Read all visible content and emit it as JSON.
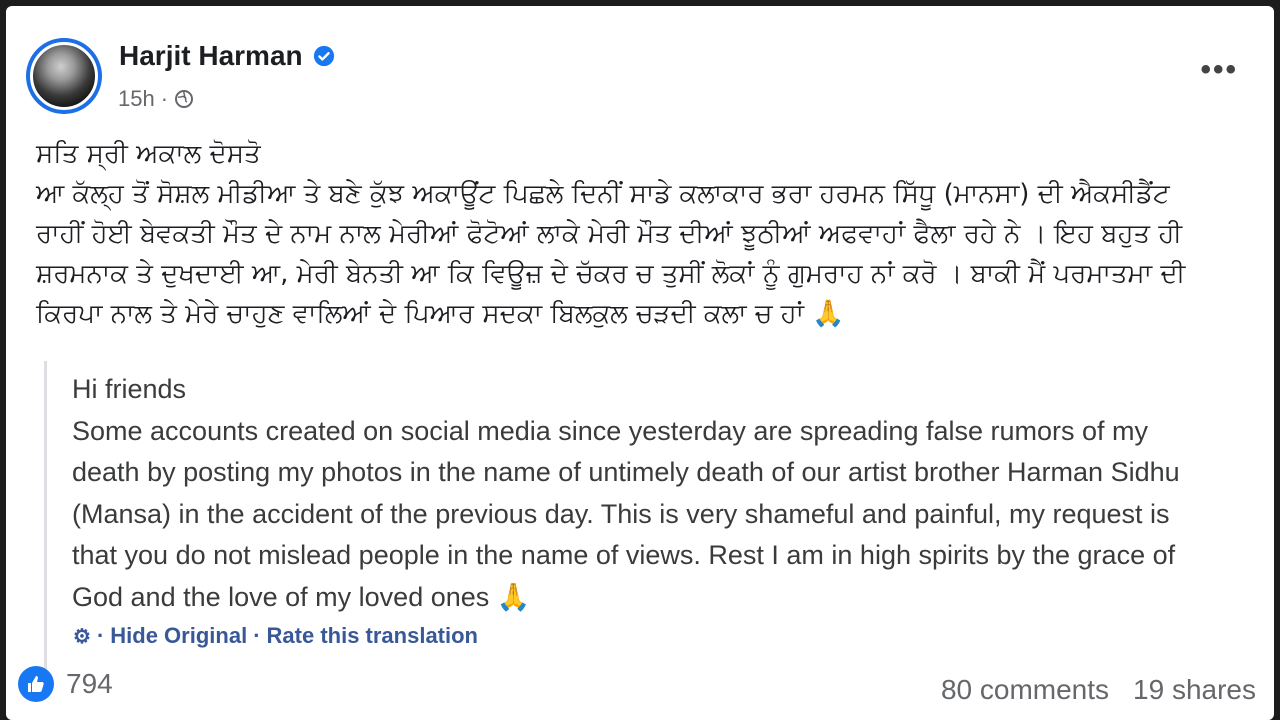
{
  "post": {
    "author": "Harjit Harman",
    "time": "15h",
    "more_label": "•••",
    "punjabi_lines": [
      "ਸਤਿ ਸ੍ਰੀ ਅਕਾਲ ਦੋਸਤੋ",
      "ਆ ਕੱਲ੍ਹ ਤੋਂ ਸੋਸ਼ਲ ਮੀਡੀਆ ਤੇ ਬਣੇ ਕੁੱਝ ਅਕਾਊਂਟ  ਪਿਛਲੇ ਦਿਨੀਂ ਸਾਡੇ ਕਲਾਕਾਰ ਭਰਾ ਹਰਮਨ ਸਿੱਧੂ (ਮਾਨਸਾ) ਦੀ ਐਕਸੀਡੈਂਟ",
      "ਰਾਹੀਂ ਹੋਈ ਬੇਵਕਤੀ ਮੌਤ ਦੇ ਨਾਮ ਨਾਲ ਮੇਰੀਆਂ ਫੋਟੋਆਂ ਲਾਕੇ ਮੇਰੀ ਮੌਤ ਦੀਆਂ ਝੂਠੀਆਂ ਅਫਵਾਹਾਂ ਫੈਲਾ ਰਹੇ ਨੇ । ਇਹ  ਬਹੁਤ ਹੀ",
      "ਸ਼ਰਮਨਾਕ ਤੇ ਦੁਖਦਾਈ ਆ, ਮੇਰੀ ਬੇਨਤੀ ਆ ਕਿ ਵਿਊਜ਼ ਦੇ ਚੱਕਰ ਚ ਤੁਸੀਂ ਲੋਕਾਂ ਨੂੰ ਗੁਮਰਾਹ ਨਾਂ ਕਰੋ । ਬਾਕੀ ਮੈਂ ਪਰਮਾਤਮਾ ਦੀ",
      "ਕਿਰਪਾ ਨਾਲ ਤੇ ਮੇਰੇ ਚਾਹੁਣ ਵਾਲਿਆਂ ਦੇ ਪਿਆਰ ਸਦਕਾ ਬਿਲਕੁਲ ਚੜਦੀ ਕਲਾ ਚ ਹਾਂ 🙏"
    ],
    "translation_lines": [
      "Hi friends",
      "Some accounts created on social media since yesterday are spreading false rumors of my",
      "death by posting my photos in the name of untimely death of our artist brother Harman Sidhu",
      "(Mansa) in the accident of the previous day. This is very shameful and painful, my request is",
      "that you do not mislead people in the name of views. Rest I am in high spirits by the grace of",
      "God and the love of my loved ones 🙏"
    ],
    "hide_original": "Hide Original",
    "rate_translation": "Rate this translation",
    "likes": "794",
    "comments": "80 comments",
    "shares": "19 shares",
    "colors": {
      "accent": "#1877f2",
      "link": "#385898",
      "muted": "#65676b"
    }
  }
}
